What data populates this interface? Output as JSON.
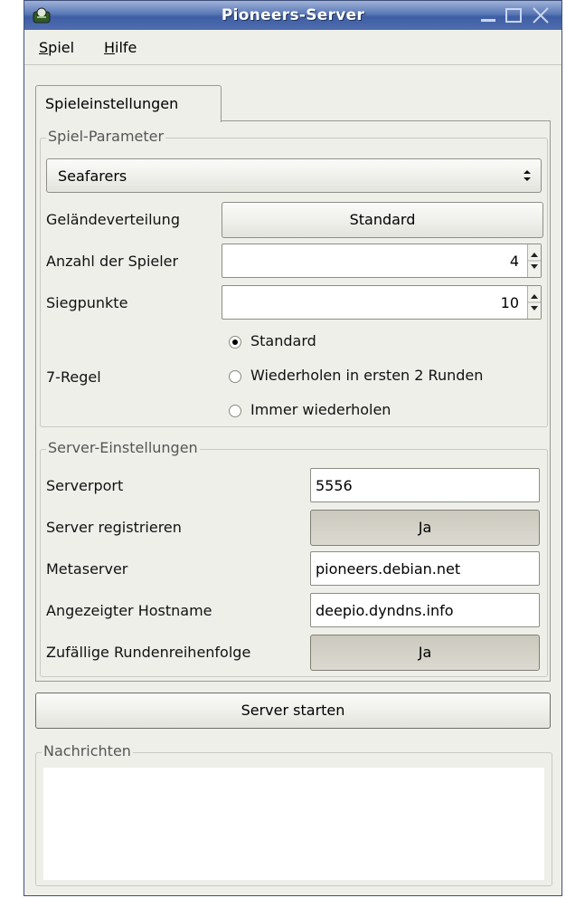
{
  "window": {
    "title": "Pioneers-Server"
  },
  "menu": {
    "items": [
      {
        "label": "Spiel",
        "key": "S"
      },
      {
        "label": "Hilfe",
        "key": "H"
      }
    ]
  },
  "tabs": [
    {
      "label": "Spieleinstellungen"
    }
  ],
  "game_params": {
    "frame_label": "Spiel-Parameter",
    "game_select": "Seafarers",
    "terrain_label": "Geländeverteilung",
    "terrain_value": "Standard",
    "players_label": "Anzahl der Spieler",
    "players_value": "4",
    "victory_label": "Siegpunkte",
    "victory_value": "10",
    "seven_rule_label": "7-Regel",
    "seven_rule_options": [
      {
        "label": "Standard",
        "selected": true
      },
      {
        "label": "Wiederholen in ersten 2 Runden",
        "selected": false
      },
      {
        "label": "Immer wiederholen",
        "selected": false
      }
    ]
  },
  "server_settings": {
    "frame_label": "Server-Einstellungen",
    "port_label": "Serverport",
    "port_value": "5556",
    "register_label": "Server registrieren",
    "register_value": "Ja",
    "metaserver_label": "Metaserver",
    "metaserver_value": "pioneers.debian.net",
    "hostname_label": "Angezeigter Hostname",
    "hostname_value": "deepio.dyndns.info",
    "random_order_label": "Zufällige Rundenreihenfolge",
    "random_order_value": "Ja"
  },
  "start_button": "Server starten",
  "messages": {
    "frame_label": "Nachrichten"
  }
}
